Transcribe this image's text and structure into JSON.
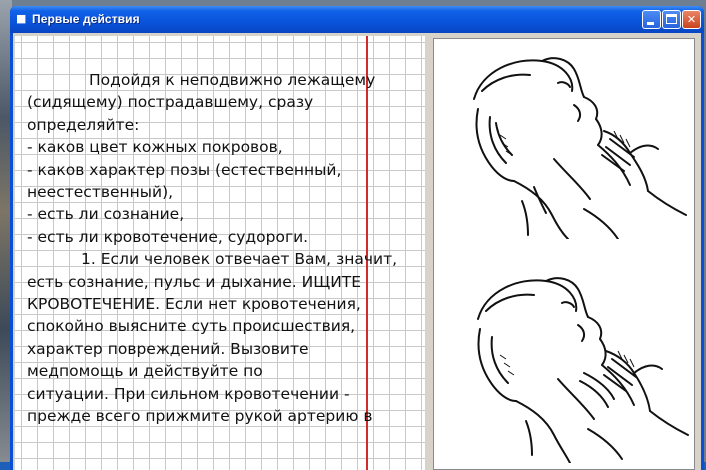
{
  "window": {
    "title": "Первые действия",
    "controls": [
      "minimize",
      "maximize",
      "close"
    ]
  },
  "text_panel": {
    "lines": [
      "Подойдя к неподвижно лежащему",
      "(сидящему) пострадавшему, сразу",
      "определяйте:",
      " - каков цвет кожных покровов,",
      " - каков характер позы (естественный,",
      "неестественный),",
      " - есть ли сознание,",
      " - есть ли кровотечение, судороги.",
      "1. Если человек отвечает Вам, значит,",
      "есть сознание, пульс и дыхание. ИЩИТЕ",
      "КРОВОТЕЧЕНИЕ. Если нет кровотечения,",
      "спокойно выясните суть происшествия,",
      "характер повреждений. Вызовите",
      "медпомощь и действуйте по",
      "ситуации. При сильном кровотечении -",
      "прежде всего прижмите рукой артерию в"
    ]
  },
  "illustrations": [
    {
      "icon": "pulse-check-illustration-1"
    },
    {
      "icon": "pulse-check-illustration-2"
    }
  ],
  "colors": {
    "titlebar": "#0953db",
    "margin_line": "#d22a2a",
    "grid": "#c8c8c8"
  }
}
